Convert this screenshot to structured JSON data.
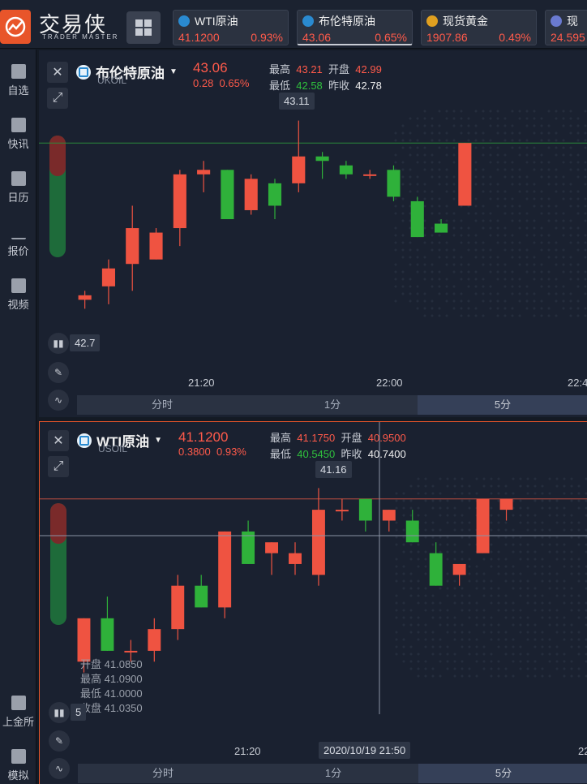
{
  "brand": {
    "name": "交易侠",
    "subtitle": "TRADER MASTER"
  },
  "tickers": [
    {
      "name": "WTI原油",
      "price": "41.1200",
      "change": "0.93%",
      "icon_color": "#2a8ad0"
    },
    {
      "name": "布伦特原油",
      "price": "43.06",
      "change": "0.65%",
      "icon_color": "#2a8ad0"
    },
    {
      "name": "现货黄金",
      "price": "1907.86",
      "change": "0.49%",
      "icon_color": "#e0a020"
    },
    {
      "name": "现",
      "price": "24.595",
      "change": "",
      "icon_color": "#6a7ad0"
    }
  ],
  "sidebar": {
    "items": [
      {
        "label": "自选",
        "icon": "watchlist-icon"
      },
      {
        "label": "快讯",
        "icon": "news-icon"
      },
      {
        "label": "日历",
        "icon": "calendar-icon"
      },
      {
        "label": "报价",
        "icon": "quote-icon"
      },
      {
        "label": "视频",
        "icon": "video-icon"
      }
    ],
    "bottom_items": [
      {
        "label": "上金所",
        "icon": "sge-icon"
      },
      {
        "label": "模拟",
        "icon": "wallet-icon"
      }
    ]
  },
  "panel1": {
    "symbol": "布伦特原油",
    "code": "UKOIL",
    "price": "43.06",
    "change_abs": "0.28",
    "change_pct": "0.65%",
    "high_label": "最高",
    "high": "43.21",
    "open_label": "开盘",
    "open": "42.99",
    "low_label": "最低",
    "low": "42.58",
    "prev_label": "昨收",
    "prev": "42.78",
    "tip_high": "43.11",
    "tip_low": "42.7",
    "time_labels": [
      "21:20",
      "22:00",
      "22:4"
    ],
    "tabs": [
      "分时",
      "1分",
      "5分"
    ],
    "active_tab": 2
  },
  "panel2": {
    "symbol": "WTI原油",
    "code": "USOIL",
    "price": "41.1200",
    "change_abs": "0.3800",
    "change_pct": "0.93%",
    "high_label": "最高",
    "high": "41.1750",
    "open_label": "开盘",
    "open": "40.9500",
    "low_label": "最低",
    "low": "40.5450",
    "prev_label": "昨收",
    "prev": "40.7400",
    "tip_high": "41.16",
    "hover": {
      "open_label": "开盘",
      "open": "41.0850",
      "high_label": "最高",
      "high": "41.0900",
      "low_label": "最低",
      "low": "41.0000",
      "close_label": "收盘",
      "close": "41.0350"
    },
    "tip_low": "5",
    "time_labels": [
      "21:20",
      "2020/10/19 21:50",
      "22"
    ],
    "tabs": [
      "分时",
      "1分",
      "5分"
    ],
    "active_tab": 2
  },
  "chart_data": [
    {
      "type": "candlestick",
      "title": "布伦特原油 UKOIL 5分",
      "ohlc": [
        [
          42.71,
          42.73,
          42.69,
          42.72
        ],
        [
          42.74,
          42.8,
          42.7,
          42.78
        ],
        [
          42.79,
          42.92,
          42.73,
          42.87
        ],
        [
          42.8,
          42.87,
          42.8,
          42.86
        ],
        [
          42.87,
          43.0,
          42.83,
          42.99
        ],
        [
          42.99,
          43.02,
          42.95,
          43.0
        ],
        [
          43.0,
          43.0,
          42.89,
          42.89
        ],
        [
          42.91,
          42.99,
          42.9,
          42.98
        ],
        [
          42.97,
          42.98,
          42.89,
          42.92
        ],
        [
          42.97,
          43.11,
          42.95,
          43.03
        ],
        [
          43.03,
          43.04,
          42.98,
          43.02
        ],
        [
          43.01,
          43.02,
          42.98,
          42.99
        ],
        [
          42.99,
          43.0,
          42.98,
          42.99
        ],
        [
          43.0,
          43.01,
          42.93,
          42.94
        ],
        [
          42.93,
          42.94,
          42.85,
          42.85
        ],
        [
          42.88,
          42.89,
          42.86,
          42.86
        ],
        [
          42.92,
          43.06,
          42.92,
          43.06
        ]
      ]
    },
    {
      "type": "candlestick",
      "title": "WTI原油 USOIL 5分",
      "ohlc": [
        [
          41.0,
          41.04,
          40.99,
          41.04
        ],
        [
          41.04,
          41.06,
          41.01,
          41.01
        ],
        [
          41.01,
          41.02,
          41.0,
          41.01
        ],
        [
          41.01,
          41.04,
          41.0,
          41.03
        ],
        [
          41.03,
          41.08,
          41.02,
          41.07
        ],
        [
          41.07,
          41.08,
          41.05,
          41.05
        ],
        [
          41.05,
          41.12,
          41.04,
          41.12
        ],
        [
          41.12,
          41.13,
          41.09,
          41.09
        ],
        [
          41.1,
          41.11,
          41.08,
          41.11
        ],
        [
          41.09,
          41.11,
          41.08,
          41.1
        ],
        [
          41.08,
          41.16,
          41.07,
          41.14
        ],
        [
          41.14,
          41.15,
          41.13,
          41.14
        ],
        [
          41.15,
          41.15,
          41.12,
          41.13
        ],
        [
          41.13,
          41.14,
          41.12,
          41.14
        ],
        [
          41.13,
          41.14,
          41.11,
          41.11
        ],
        [
          41.1,
          41.11,
          41.07,
          41.07
        ],
        [
          41.08,
          41.09,
          41.07,
          41.09
        ],
        [
          41.1,
          41.15,
          41.1,
          41.15
        ],
        [
          41.14,
          41.15,
          41.13,
          41.15
        ]
      ]
    }
  ],
  "colors": {
    "up": "#ef5341",
    "down": "#2fb13a",
    "accent": "#e8552a"
  }
}
